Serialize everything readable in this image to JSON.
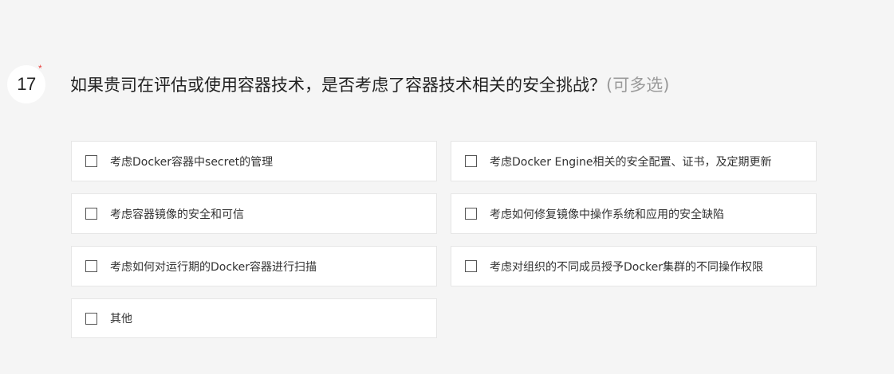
{
  "question": {
    "number": "17",
    "required_mark": "*",
    "title": "如果贵司在评估或使用容器技术，是否考虑了容器技术相关的安全挑战？",
    "hint": "(可多选)"
  },
  "options": [
    {
      "label": "考虑Docker容器中secret的管理",
      "checked": false
    },
    {
      "label": "考虑Docker Engine相关的安全配置、证书，及定期更新",
      "checked": false
    },
    {
      "label": "考虑容器镜像的安全和可信",
      "checked": false
    },
    {
      "label": "考虑如何修复镜像中操作系统和应用的安全缺陷",
      "checked": false
    },
    {
      "label": "考虑如何对运行期的Docker容器进行扫描",
      "checked": false
    },
    {
      "label": "考虑对组织的不同成员授予Docker集群的不同操作权限",
      "checked": false
    },
    {
      "label": "其他",
      "checked": false
    }
  ],
  "colors": {
    "page_background": "#f5f5f5",
    "required": "#e8423f",
    "hint": "#9a9a9a"
  }
}
